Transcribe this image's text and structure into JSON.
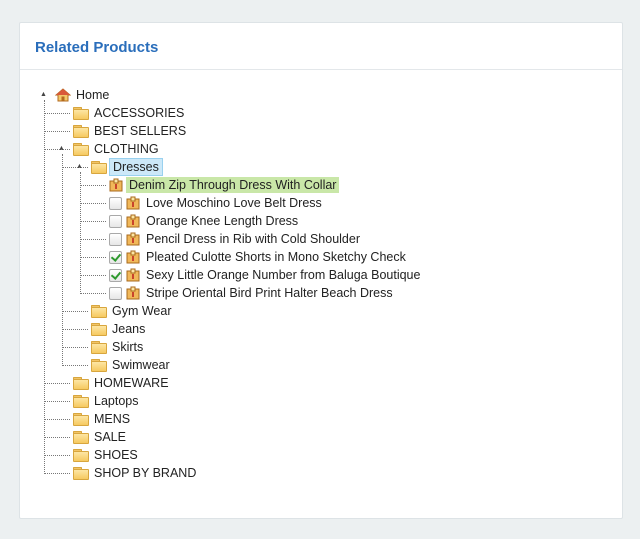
{
  "panel": {
    "title": "Related Products"
  },
  "tree": {
    "root": "Home",
    "categories": [
      {
        "label": "ACCESSORIES"
      },
      {
        "label": "BEST SELLERS"
      },
      {
        "label": "CLOTHING"
      },
      {
        "label": "HOMEWARE"
      },
      {
        "label": "Laptops"
      },
      {
        "label": "MENS"
      },
      {
        "label": "SALE"
      },
      {
        "label": "SHOES"
      },
      {
        "label": "SHOP BY BRAND"
      }
    ],
    "clothing_children": [
      {
        "label": "Dresses"
      },
      {
        "label": "Gym Wear"
      },
      {
        "label": "Jeans"
      },
      {
        "label": "Skirts"
      },
      {
        "label": "Swimwear"
      }
    ],
    "dresses_products": [
      {
        "label": "Denim Zip Through Dress With Collar",
        "checked": null
      },
      {
        "label": "Love Moschino Love Belt Dress",
        "checked": false
      },
      {
        "label": "Orange Knee Length Dress",
        "checked": false
      },
      {
        "label": "Pencil Dress in Rib with Cold Shoulder",
        "checked": false
      },
      {
        "label": "Pleated Culotte Shorts in Mono Sketchy Check",
        "checked": true
      },
      {
        "label": "Sexy Little Orange Number from Baluga Boutique",
        "checked": true
      },
      {
        "label": "Stripe Oriental Bird Print Halter Beach Dress",
        "checked": false
      }
    ]
  }
}
